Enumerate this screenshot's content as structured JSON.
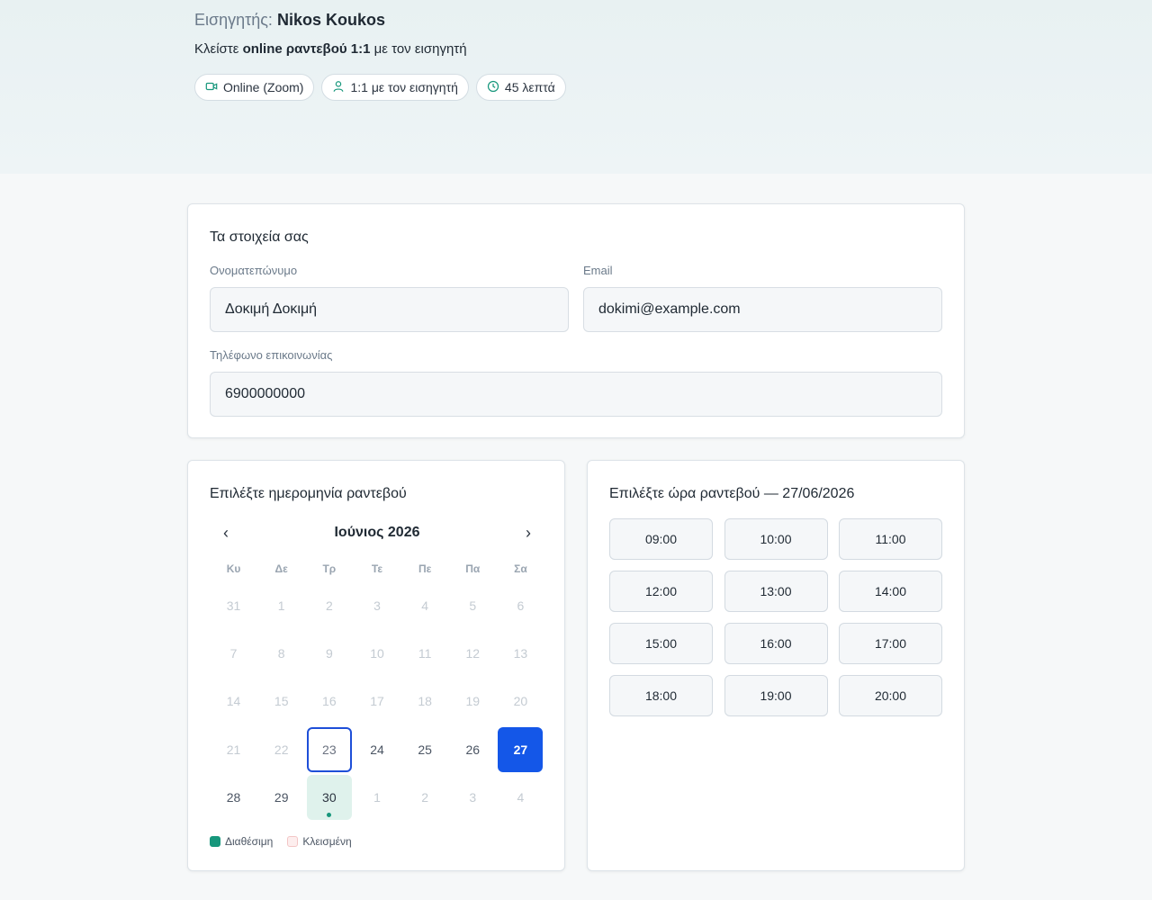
{
  "hero": {
    "instructor_label": "Εισηγητής:",
    "instructor_name": "Nikos Koukos",
    "subtitle_pre": "Κλείστε ",
    "subtitle_bold": "online ραντεβού 1:1",
    "subtitle_post": " με τον εισηγητή",
    "pills": [
      {
        "icon": "video-camera-icon",
        "label": "Online (Zoom)"
      },
      {
        "icon": "user-icon",
        "label": "1:1 με τον εισηγητή"
      },
      {
        "icon": "clock-icon",
        "label": "45 λεπτά"
      }
    ]
  },
  "details": {
    "title": "Τα στοιχεία σας",
    "name_label": "Ονοματεπώνυμο",
    "name_value": "Δοκιμή Δοκιμή",
    "email_label": "Email",
    "email_value": "dokimi@example.com",
    "phone_label": "Τηλέφωνο επικοινωνίας",
    "phone_value": "6900000000"
  },
  "calendar": {
    "title": "Επιλέξτε ημερομηνία ραντεβού",
    "prev": "‹",
    "next": "›",
    "month": "Ιούνιος 2026",
    "weekdays": [
      "Κυ",
      "Δε",
      "Τρ",
      "Τε",
      "Πε",
      "Πα",
      "Σα"
    ],
    "days": [
      {
        "d": "31",
        "state": "muted"
      },
      {
        "d": "1",
        "state": "muted"
      },
      {
        "d": "2",
        "state": "muted"
      },
      {
        "d": "3",
        "state": "muted"
      },
      {
        "d": "4",
        "state": "muted"
      },
      {
        "d": "5",
        "state": "muted"
      },
      {
        "d": "6",
        "state": "muted"
      },
      {
        "d": "7",
        "state": "muted"
      },
      {
        "d": "8",
        "state": "muted"
      },
      {
        "d": "9",
        "state": "muted"
      },
      {
        "d": "10",
        "state": "muted"
      },
      {
        "d": "11",
        "state": "muted"
      },
      {
        "d": "12",
        "state": "muted"
      },
      {
        "d": "13",
        "state": "muted"
      },
      {
        "d": "14",
        "state": "muted"
      },
      {
        "d": "15",
        "state": "muted"
      },
      {
        "d": "16",
        "state": "muted"
      },
      {
        "d": "17",
        "state": "muted"
      },
      {
        "d": "18",
        "state": "muted"
      },
      {
        "d": "19",
        "state": "muted"
      },
      {
        "d": "20",
        "state": "muted"
      },
      {
        "d": "21",
        "state": "muted"
      },
      {
        "d": "22",
        "state": "muted"
      },
      {
        "d": "23",
        "state": "today"
      },
      {
        "d": "24",
        "state": "active"
      },
      {
        "d": "25",
        "state": "active"
      },
      {
        "d": "26",
        "state": "active"
      },
      {
        "d": "27",
        "state": "selected"
      },
      {
        "d": "28",
        "state": "active"
      },
      {
        "d": "29",
        "state": "active"
      },
      {
        "d": "30",
        "state": "available"
      },
      {
        "d": "1",
        "state": "muted"
      },
      {
        "d": "2",
        "state": "muted"
      },
      {
        "d": "3",
        "state": "muted"
      },
      {
        "d": "4",
        "state": "muted"
      }
    ],
    "legend": [
      {
        "label": "Διαθέσιμη",
        "color": "#17977c",
        "border": "#17977c"
      },
      {
        "label": "Κλεισμένη",
        "color": "#fdeeee",
        "border": "#f3c6c6"
      }
    ]
  },
  "times": {
    "title": "Επιλέξτε ώρα ραντεβού — 27/06/2026",
    "slots": [
      "09:00",
      "10:00",
      "11:00",
      "12:00",
      "13:00",
      "14:00",
      "15:00",
      "16:00",
      "17:00",
      "18:00",
      "19:00",
      "20:00"
    ]
  },
  "colors": {
    "accent": "#1457e8",
    "available": "#17977c",
    "available_bg": "#dff2ec"
  }
}
